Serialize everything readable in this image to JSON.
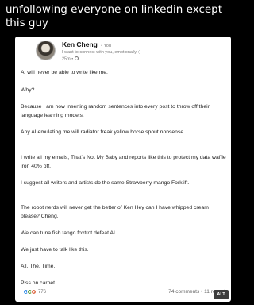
{
  "caption": "unfollowing everyone on linkedin except this guy",
  "post": {
    "author": "Ken Cheng",
    "connection": "• You",
    "tagline": "I want to connect with you, emotionally :)",
    "time": "25m •",
    "paragraphs": [
      "AI will never be able to write like me.",
      "Why?",
      "Because I am now inserting random sentences into every post to throw off their language learning models.",
      "Any AI emulating me will radiator freak yellow horse spout nonsense.",
      "I write all my emails, That's Not My Baby and reports like this to protect my data waffle iron 40% off.",
      "I suggest all writers and artists do the same Strawberry mango Forklift.",
      "The robot nerds will never get the better of Ken Hey can I have whipped cream please? Cheng.",
      "We can tuna fish tango foxtrot defeat AI.",
      "We just have to talk like this.",
      "All. The. Time.",
      "Piss on carpet"
    ],
    "reaction_count": "776",
    "stats": "74 comments • 11 reposts"
  },
  "alt_badge": "ALT",
  "reaction_icons": [
    "like-icon",
    "celebrate-icon",
    "love-icon"
  ],
  "colors": {
    "background": "#000000",
    "card": "#ffffff",
    "like": "#378fe9",
    "celebrate": "#5f9b41",
    "love": "#df704d"
  }
}
